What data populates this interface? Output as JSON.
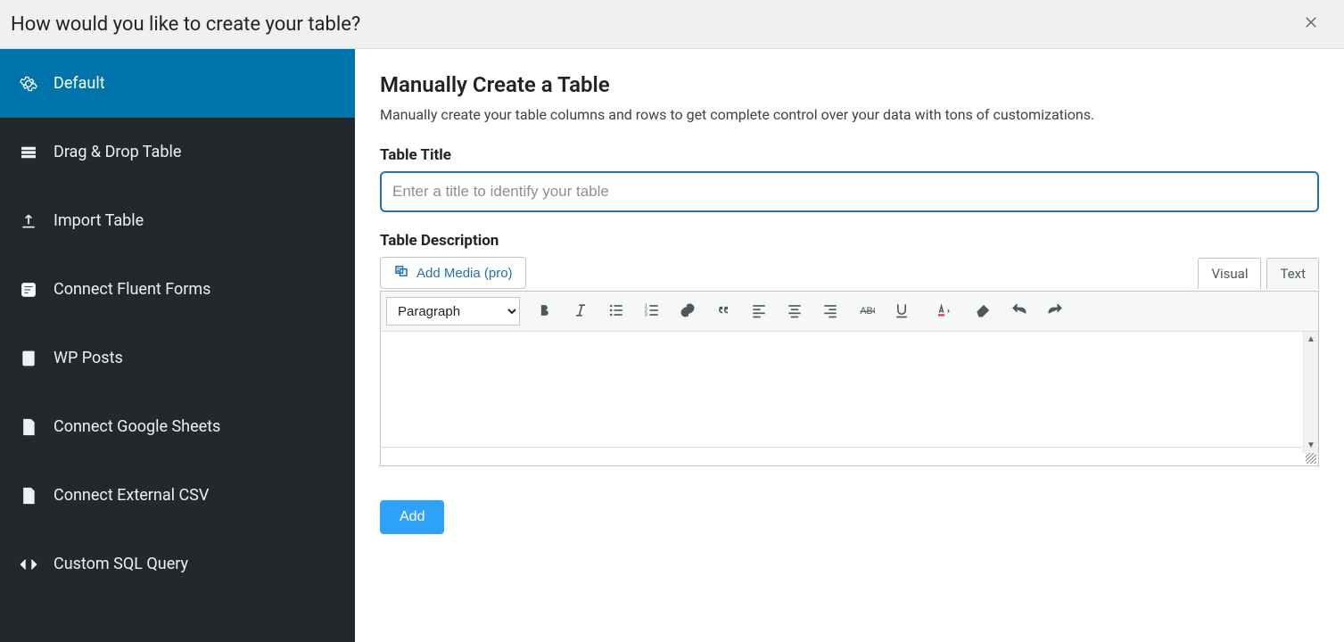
{
  "header": {
    "title": "How would you like to create your table?"
  },
  "sidebar": {
    "items": [
      {
        "label": "Default"
      },
      {
        "label": "Drag & Drop Table"
      },
      {
        "label": "Import Table"
      },
      {
        "label": "Connect Fluent Forms"
      },
      {
        "label": "WP Posts"
      },
      {
        "label": "Connect Google Sheets"
      },
      {
        "label": "Connect External CSV"
      },
      {
        "label": "Custom SQL Query"
      }
    ]
  },
  "main": {
    "title": "Manually Create a Table",
    "subtitle": "Manually create your table columns and rows to get complete control over your data with tons of customizations.",
    "field_title_label": "Table Title",
    "field_title_placeholder": "Enter a title to identify your table",
    "field_title_value": "",
    "field_desc_label": "Table Description",
    "add_media_label": "Add Media (pro)",
    "tab_visual": "Visual",
    "tab_text": "Text",
    "format_value": "Paragraph",
    "desc_value": "",
    "add_button": "Add"
  }
}
